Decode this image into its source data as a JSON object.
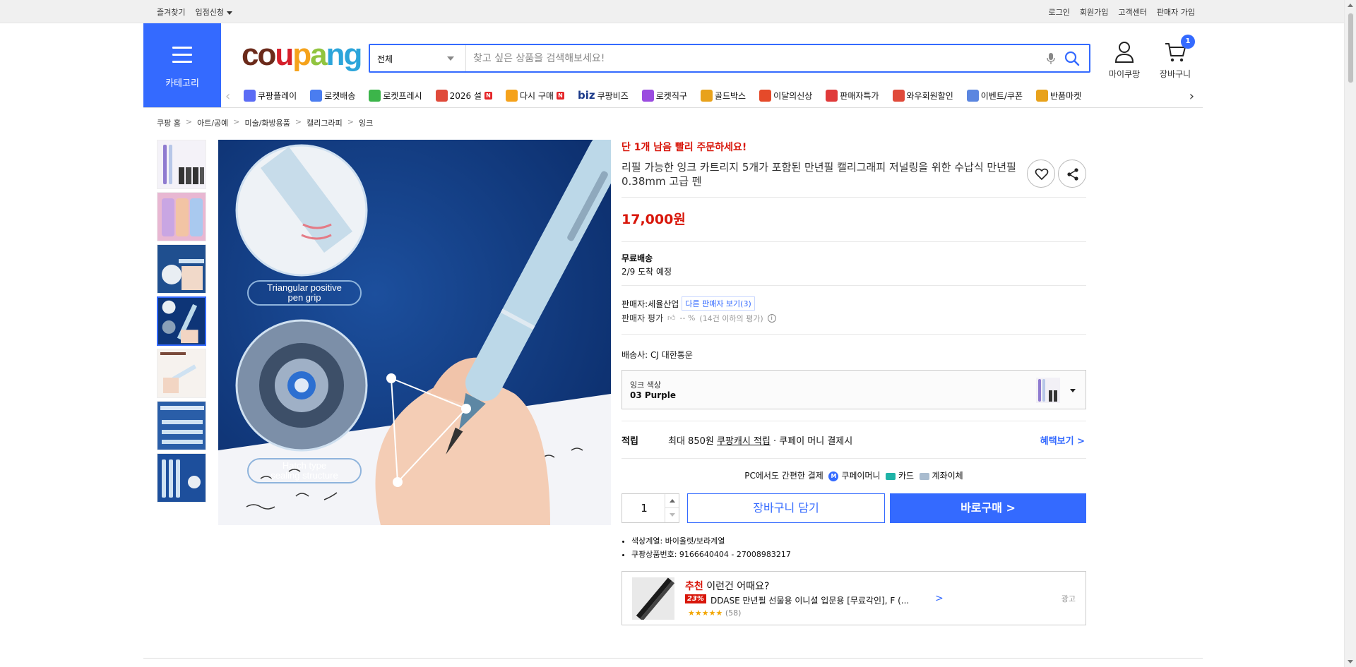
{
  "topbar": {
    "left": [
      "즐겨찾기",
      "입점신청"
    ],
    "right": [
      "로그인",
      "회원가입",
      "고객센터",
      "판매자 가입"
    ]
  },
  "header": {
    "category_label": "카테고리",
    "logo_letters": [
      {
        "ch": "c",
        "color": "#6b2a1a"
      },
      {
        "ch": "o",
        "color": "#6b2a1a"
      },
      {
        "ch": "u",
        "color": "#d51f2a"
      },
      {
        "ch": "p",
        "color": "#f5a21b"
      },
      {
        "ch": "a",
        "color": "#91c43f"
      },
      {
        "ch": "n",
        "color": "#2ca5da"
      },
      {
        "ch": "g",
        "color": "#2ca5da"
      }
    ],
    "search_category": "전체",
    "search_placeholder": "찾고 싶은 상품을 검색해보세요!",
    "mycoupang_label": "마이쿠팡",
    "cart_label": "장바구니",
    "cart_count": "1"
  },
  "gnb": [
    {
      "label": "쿠팡플레이",
      "color": "#5b6cf5",
      "new": false
    },
    {
      "label": "로켓배송",
      "color": "#4a7df0",
      "new": false
    },
    {
      "label": "로켓프레시",
      "color": "#3cb54a",
      "new": false
    },
    {
      "label": "2026 설",
      "color": "#e04a3a",
      "new": true
    },
    {
      "label": "다시 구매",
      "color": "#f5a21b",
      "new": true
    },
    {
      "label": "쿠팡비즈",
      "color": "#1b3a8a",
      "new": false,
      "prefix": "biz"
    },
    {
      "label": "로켓직구",
      "color": "#9b4ce0",
      "new": false
    },
    {
      "label": "골드박스",
      "color": "#e8a21b",
      "new": false
    },
    {
      "label": "이달의신상",
      "color": "#e54a2a",
      "new": false
    },
    {
      "label": "판매자특가",
      "color": "#e03a3a",
      "new": false
    },
    {
      "label": "와우회원할인",
      "color": "#e04a3a",
      "new": false
    },
    {
      "label": "이벤트/쿠폰",
      "color": "#5b86e0",
      "new": false
    },
    {
      "label": "반품마켓",
      "color": "#e8a21b",
      "new": false
    }
  ],
  "breadcrumb": [
    "쿠팡 홈",
    "아트/공예",
    "미술/화방용품",
    "캘리그라피",
    "잉크"
  ],
  "product": {
    "urgent": "단 1개 남음 빨리 주문하세요!",
    "title": "리필 가능한 잉크 카트리지 5개가 포함된 만년필 캘리그래피 저널링을 위한 수납식 만년필 0.38mm 고급 펜",
    "price": "17,000원",
    "shipping_title": "무료배송",
    "shipping_date": "2/9 도착 예정",
    "seller_label": "판매자:",
    "seller_name": "세율산업",
    "other_sellers": "다른 판매자 보기(3)",
    "rating_label": "판매자 평가",
    "rating_value": "-- %",
    "rating_note": "(14건 이하의 평가)",
    "carrier": "배송사:  CJ 대한통운",
    "option_label": "잉크 색상",
    "option_value": "03 Purple",
    "reward_title": "적립",
    "reward_text1": "최대 850원 ",
    "reward_link": "쿠팡캐시 적립",
    "reward_text2": " · 쿠페이 머니 결제시",
    "reward_more": "혜택보기 >",
    "pay_title": "PC에서도 간편한 결제",
    "pay_coupay": "쿠페이머니",
    "pay_card": "카드",
    "pay_bank": "계좌이체",
    "quantity": "1",
    "add_cart": "장바구니 담기",
    "buy_now": "바로구매 >",
    "bullets": [
      "색상계열: 바이올렛/보라계열",
      "쿠팡상품번호: 9166640404 - 27008983217"
    ],
    "image_texts": [
      "Triangular positive pen grip",
      "Hatch type sealing structure"
    ]
  },
  "reco": {
    "head_red": "추천",
    "head": " 이런건 어때요?",
    "discount": "23%",
    "name": "DDASE 만년필 선물용 이니셜 입문용 [무료각인], F (...",
    "stars": "★★★★★",
    "count": "(58)",
    "ad": "광고",
    "rating": 5
  }
}
